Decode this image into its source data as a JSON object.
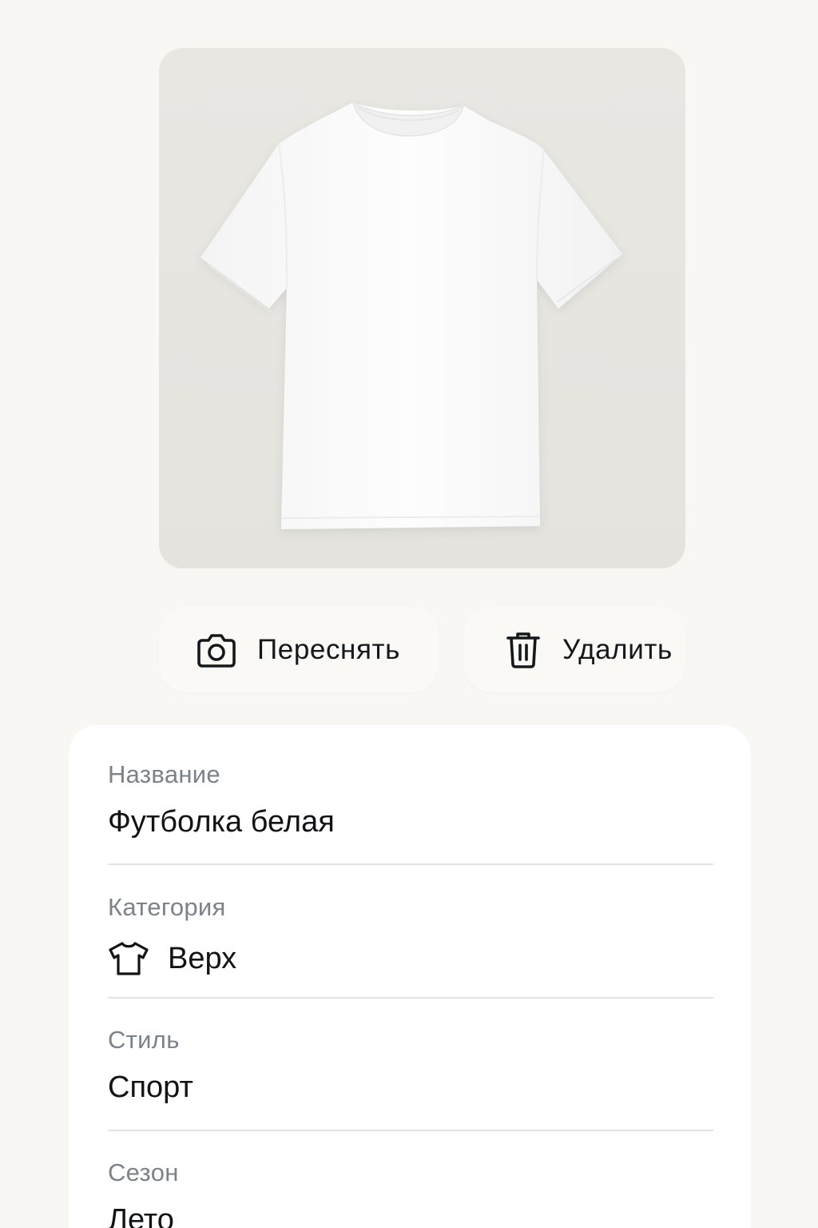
{
  "photo": {
    "icon": "t-shirt-photo"
  },
  "actions": {
    "retake": {
      "label": "Переснять",
      "icon": "camera-icon"
    },
    "delete": {
      "label": "Удалить",
      "icon": "trash-icon"
    }
  },
  "details": {
    "name": {
      "label": "Название",
      "value": "Футболка белая"
    },
    "category": {
      "label": "Категория",
      "value": "Верх",
      "icon": "t-shirt-icon"
    },
    "style": {
      "label": "Стиль",
      "value": "Спорт"
    },
    "season": {
      "label": "Сезон",
      "value": "Лето"
    }
  },
  "colors": {
    "background": "#f8f7f3",
    "photo_bg": "#e7e5e0",
    "button_bg": "#faf9f5",
    "label_gray": "#7b838a",
    "text": "#111417"
  }
}
